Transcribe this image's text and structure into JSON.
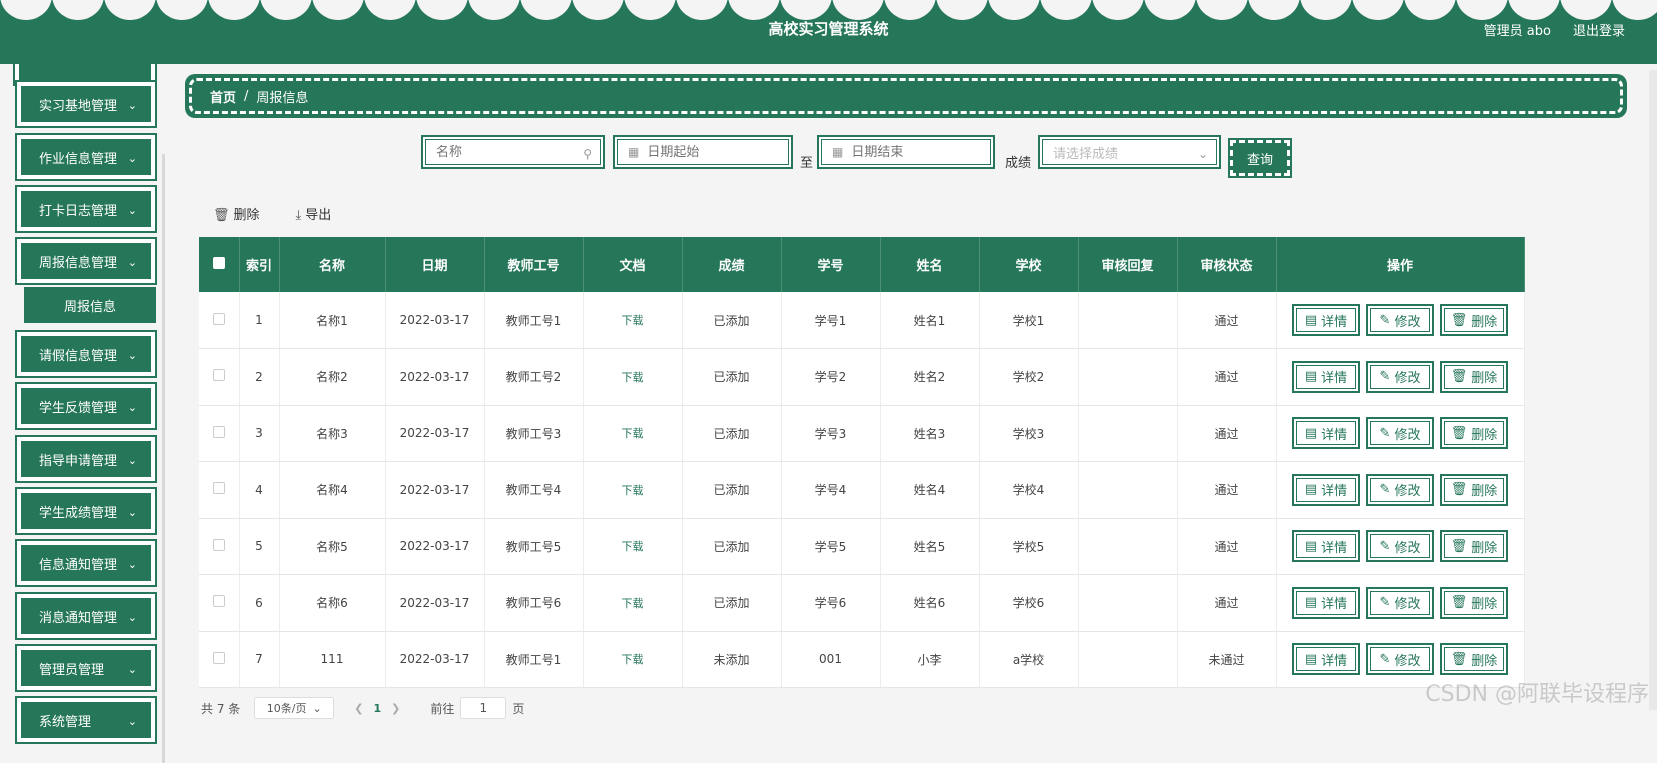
{
  "header": {
    "title": "高校实习管理系统",
    "user": "管理员 abo",
    "logout": "退出登录"
  },
  "sidebar": {
    "items": [
      {
        "label": "实习基地管理"
      },
      {
        "label": "作业信息管理"
      },
      {
        "label": "打卡日志管理"
      },
      {
        "label": "周报信息管理"
      },
      {
        "label": "请假信息管理"
      },
      {
        "label": "学生反馈管理"
      },
      {
        "label": "指导申请管理"
      },
      {
        "label": "学生成绩管理"
      },
      {
        "label": "信息通知管理"
      },
      {
        "label": "消息通知管理"
      },
      {
        "label": "管理员管理"
      },
      {
        "label": "系统管理"
      }
    ],
    "sub_item": "周报信息"
  },
  "breadcrumb": {
    "home": "首页",
    "sep": "/",
    "current": "周报信息"
  },
  "search": {
    "name_placeholder": "名称",
    "date_start_placeholder": "日期起始",
    "to_label": "至",
    "date_end_placeholder": "日期结束",
    "grade_label": "成绩",
    "grade_placeholder": "请选择成绩",
    "query_button": "查询"
  },
  "actions": {
    "delete": "删除",
    "export": "导出"
  },
  "table": {
    "headers": [
      "索引",
      "名称",
      "日期",
      "教师工号",
      "文档",
      "成绩",
      "学号",
      "姓名",
      "学校",
      "审核回复",
      "审核状态",
      "操作"
    ],
    "rows": [
      {
        "index": "1",
        "name": "名称1",
        "date": "2022-03-17",
        "teacher": "教师工号1",
        "doc": "下载",
        "grade": "已添加",
        "sid": "学号1",
        "sname": "姓名1",
        "school": "学校1",
        "reply": "",
        "status": "通过"
      },
      {
        "index": "2",
        "name": "名称2",
        "date": "2022-03-17",
        "teacher": "教师工号2",
        "doc": "下载",
        "grade": "已添加",
        "sid": "学号2",
        "sname": "姓名2",
        "school": "学校2",
        "reply": "",
        "status": "通过"
      },
      {
        "index": "3",
        "name": "名称3",
        "date": "2022-03-17",
        "teacher": "教师工号3",
        "doc": "下载",
        "grade": "已添加",
        "sid": "学号3",
        "sname": "姓名3",
        "school": "学校3",
        "reply": "",
        "status": "通过"
      },
      {
        "index": "4",
        "name": "名称4",
        "date": "2022-03-17",
        "teacher": "教师工号4",
        "doc": "下载",
        "grade": "已添加",
        "sid": "学号4",
        "sname": "姓名4",
        "school": "学校4",
        "reply": "",
        "status": "通过"
      },
      {
        "index": "5",
        "name": "名称5",
        "date": "2022-03-17",
        "teacher": "教师工号5",
        "doc": "下载",
        "grade": "已添加",
        "sid": "学号5",
        "sname": "姓名5",
        "school": "学校5",
        "reply": "",
        "status": "通过"
      },
      {
        "index": "6",
        "name": "名称6",
        "date": "2022-03-17",
        "teacher": "教师工号6",
        "doc": "下载",
        "grade": "已添加",
        "sid": "学号6",
        "sname": "姓名6",
        "school": "学校6",
        "reply": "",
        "status": "通过"
      },
      {
        "index": "7",
        "name": "111",
        "date": "2022-03-17",
        "teacher": "教师工号1",
        "doc": "下载",
        "grade": "未添加",
        "sid": "001",
        "sname": "小李",
        "school": "a学校",
        "reply": "",
        "status": "未通过"
      }
    ],
    "ops": {
      "detail": "详情",
      "edit": "修改",
      "delete": "删除"
    }
  },
  "pagination": {
    "total": "共 7 条",
    "page_size": "10条/页",
    "current_page": "1",
    "goto_label": "前往",
    "goto_value": "1",
    "page_suffix": "页"
  },
  "watermark": "CSDN @阿联毕设程序",
  "colors": {
    "primary": "#26775a",
    "background": "#f4f4f4"
  },
  "icons": [
    "search-icon",
    "calendar-icon",
    "chevron-down-icon",
    "delete-icon",
    "download-icon",
    "detail-icon",
    "edit-icon",
    "chevron-left-icon",
    "chevron-right-icon"
  ]
}
